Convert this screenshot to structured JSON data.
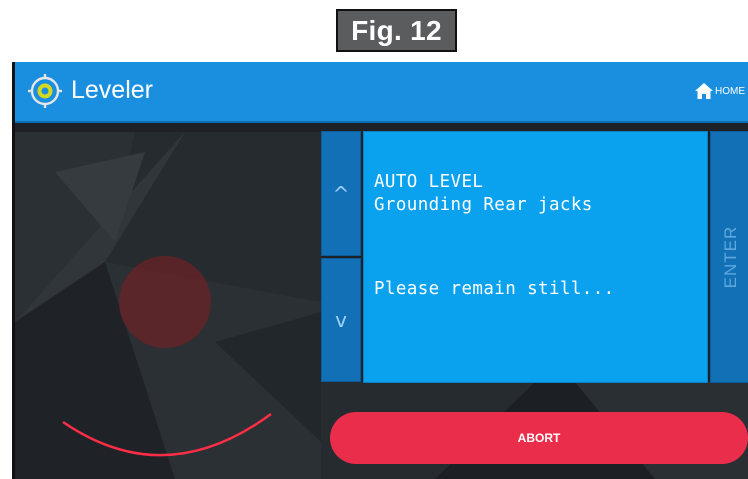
{
  "figure": {
    "label": "Fig. 12"
  },
  "app": {
    "title": "Leveler",
    "icon": "target-icon",
    "accent_color": "#1a8fe0"
  },
  "header": {
    "home_label": "HOME",
    "home_icon": "home-icon"
  },
  "controls": {
    "up_glyph": "^",
    "down_glyph": "v",
    "enter_label": "ENTER",
    "abort_label": "ABORT"
  },
  "display": {
    "lines": [
      "AUTO LEVEL",
      "Grounding Rear jacks",
      "Please remain still..."
    ],
    "background_color": "#0aa2ef"
  },
  "colors": {
    "abort": "#ea2d4b",
    "arc": "#ff2d45"
  }
}
